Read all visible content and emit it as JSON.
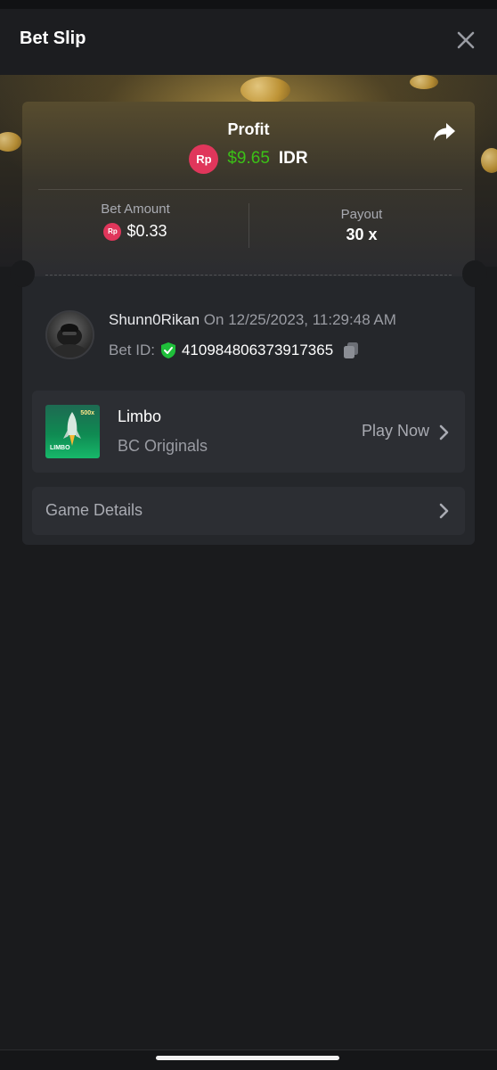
{
  "header": {
    "title": "Bet Slip"
  },
  "profit": {
    "label": "Profit",
    "coin_symbol": "Rp",
    "value": "$9.65",
    "currency": "IDR"
  },
  "bet_amount": {
    "label": "Bet Amount",
    "coin_symbol": "Rp",
    "value": "$0.33"
  },
  "payout": {
    "label": "Payout",
    "value": "30 x"
  },
  "user": {
    "name": "Shunn0Rikan",
    "on_text": " On 12/25/2023, 11:29:48 AM",
    "bet_id_label": "Bet ID:",
    "bet_id": "410984806373917365"
  },
  "game": {
    "name": "Limbo",
    "provider": "BC Originals",
    "action_label": "Play Now",
    "thumb_label": "LIMBO",
    "thumb_multiplier": "500x"
  },
  "details": {
    "label": "Game Details"
  },
  "colors": {
    "profit_green": "#3bc117",
    "coin_red": "#e0365b",
    "verified_green": "#1fbf3a"
  }
}
